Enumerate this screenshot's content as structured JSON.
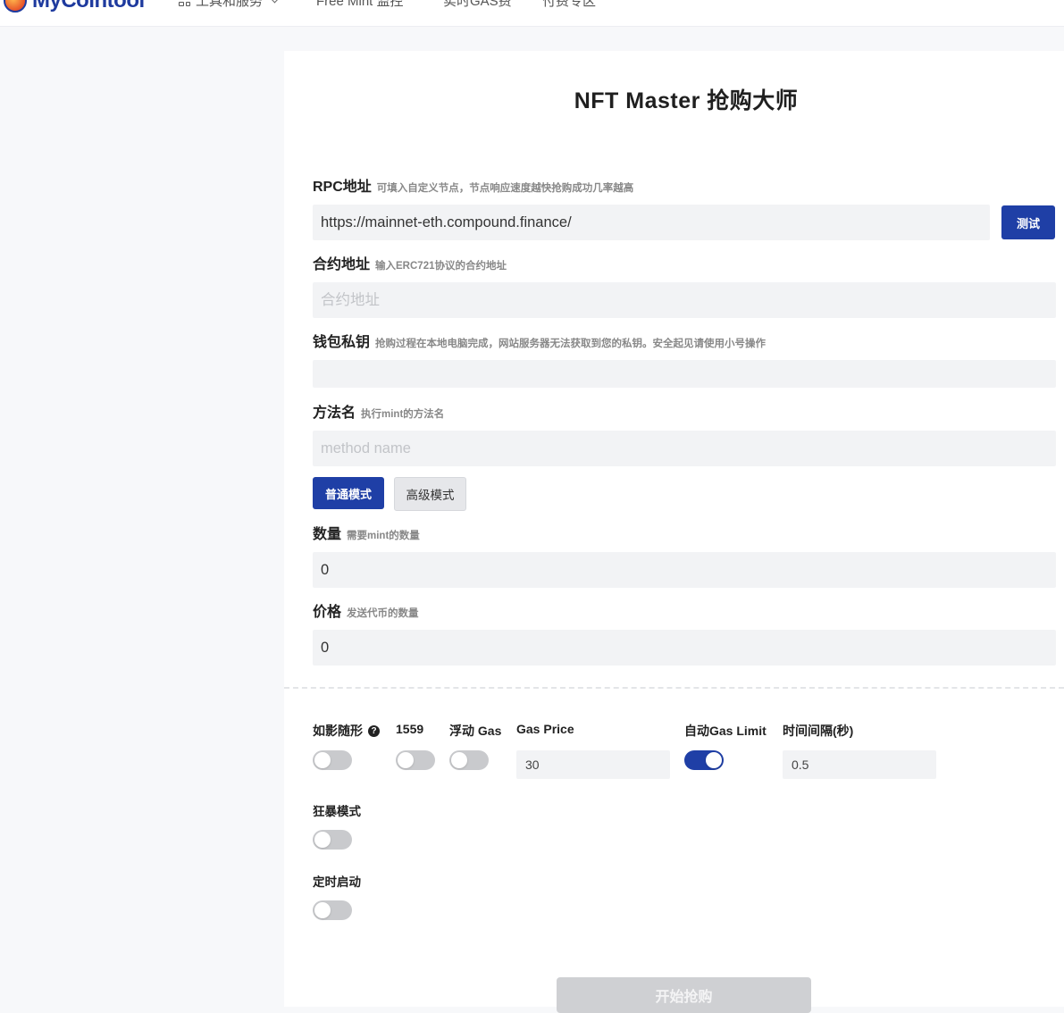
{
  "nav": {
    "logo_text": "MyCointool",
    "items": [
      {
        "label": "工具和服务",
        "icon": "grid-icon",
        "has_dropdown": true
      },
      {
        "label": "Free Mint 监控"
      },
      {
        "label": "实时GAS费"
      },
      {
        "label": "付费专区"
      }
    ]
  },
  "page": {
    "title": "NFT Master 抢购大师"
  },
  "fields": {
    "rpc": {
      "label": "RPC地址",
      "hint": "可填入自定义节点，节点响应速度越快抢购成功几率越高",
      "value": "https://mainnet-eth.compound.finance/",
      "test_button": "测试"
    },
    "contract": {
      "label": "合约地址",
      "hint": "输入ERC721协议的合约地址",
      "placeholder": "合约地址",
      "value": ""
    },
    "private_key": {
      "label": "钱包私钥",
      "hint": "抢购过程在本地电脑完成，网站服务器无法获取到您的私钥。安全起见请使用小号操作",
      "value": ""
    },
    "method": {
      "label": "方法名",
      "hint": "执行mint的方法名",
      "placeholder": "method name",
      "value": ""
    },
    "quantity": {
      "label": "数量",
      "hint": "需要mint的数量",
      "value": "0"
    },
    "price": {
      "label": "价格",
      "hint": "发送代币的数量",
      "value": "0"
    }
  },
  "modes": {
    "normal": "普通模式",
    "advanced": "高级模式",
    "active": "normal"
  },
  "options": {
    "shadow": {
      "label": "如影随形",
      "help": "?",
      "on": false
    },
    "eip1559": {
      "label": "1559",
      "on": false
    },
    "float_gas": {
      "label": "浮动 Gas",
      "on": false
    },
    "gas_price": {
      "label": "Gas Price",
      "value": "30"
    },
    "auto_gas_limit": {
      "label": "自动Gas Limit",
      "on": true
    },
    "interval": {
      "label": "时间间隔(秒)",
      "value": "0.5"
    },
    "rage_mode": {
      "label": "狂暴模式",
      "on": false
    },
    "scheduled": {
      "label": "定时启动",
      "on": false
    }
  },
  "actions": {
    "start": "开始抢购"
  },
  "colors": {
    "primary": "#1f3fa6",
    "input_bg": "#f2f3f5",
    "disabled": "#cfd0d3"
  }
}
